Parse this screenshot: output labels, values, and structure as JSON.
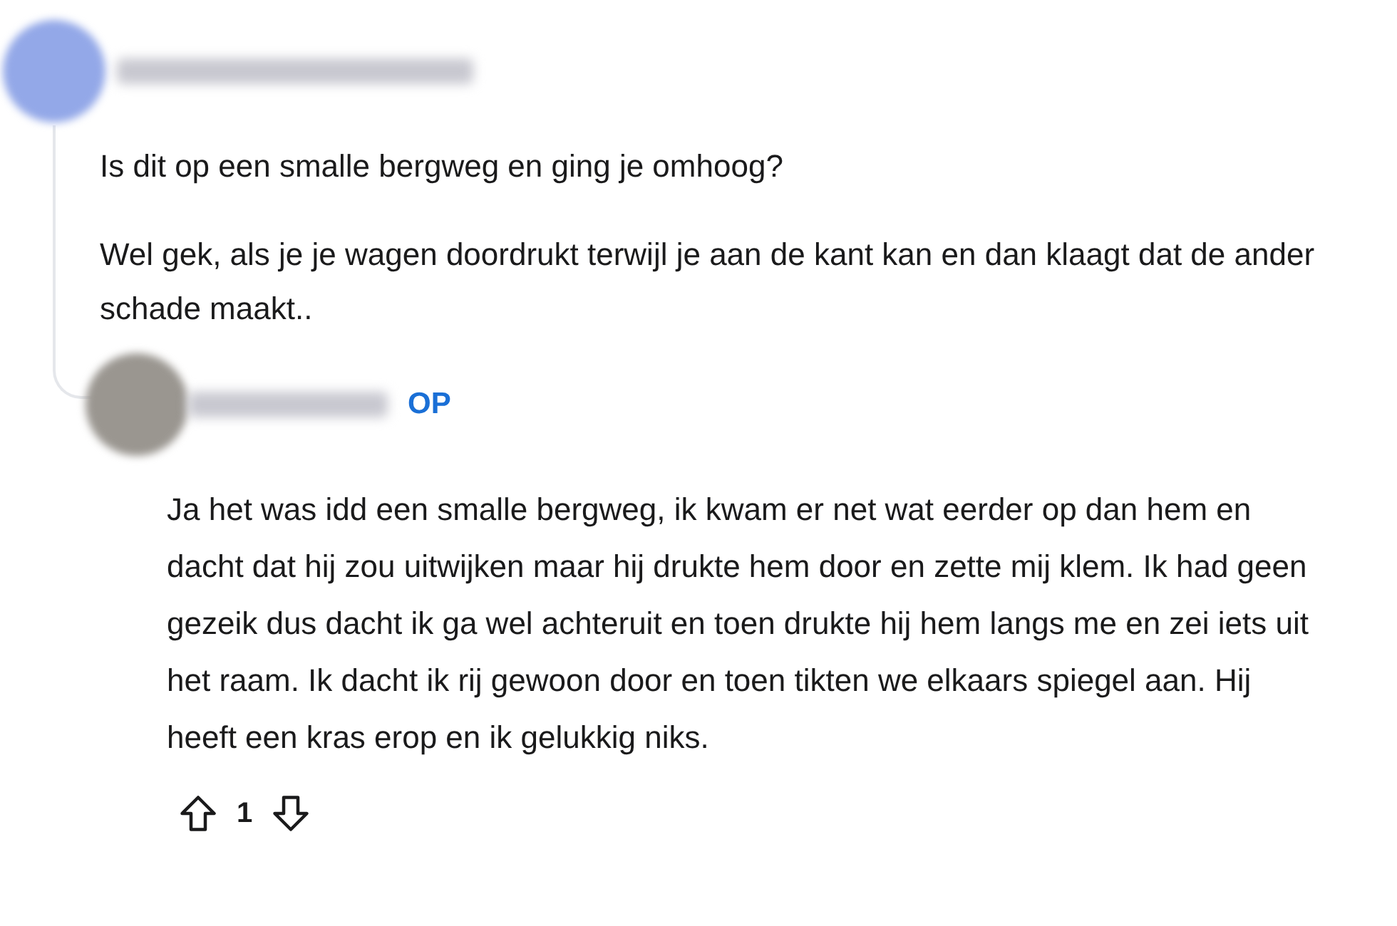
{
  "comment": {
    "paragraphs": [
      "Is dit op een smalle bergweg en ging je omhoog?",
      "Wel gek, als je je wagen doordrukt terwijl je aan de kant kan en dan klaagt dat de ander schade maakt.."
    ]
  },
  "reply": {
    "badge": "OP",
    "paragraphs": [
      "Ja het was idd een smalle bergweg, ik kwam er net wat eerder op dan hem en dacht dat hij zou uitwijken maar hij drukte hem door en zette mij klem. Ik had geen gezeik dus dacht ik ga wel achteruit en toen drukte hij hem langs me en zei iets uit het raam. Ik dacht ik rij gewoon door en toen tikten we elkaars spiegel aan. Hij heeft een kras erop en ik gelukkig niks."
    ],
    "score": "1"
  }
}
